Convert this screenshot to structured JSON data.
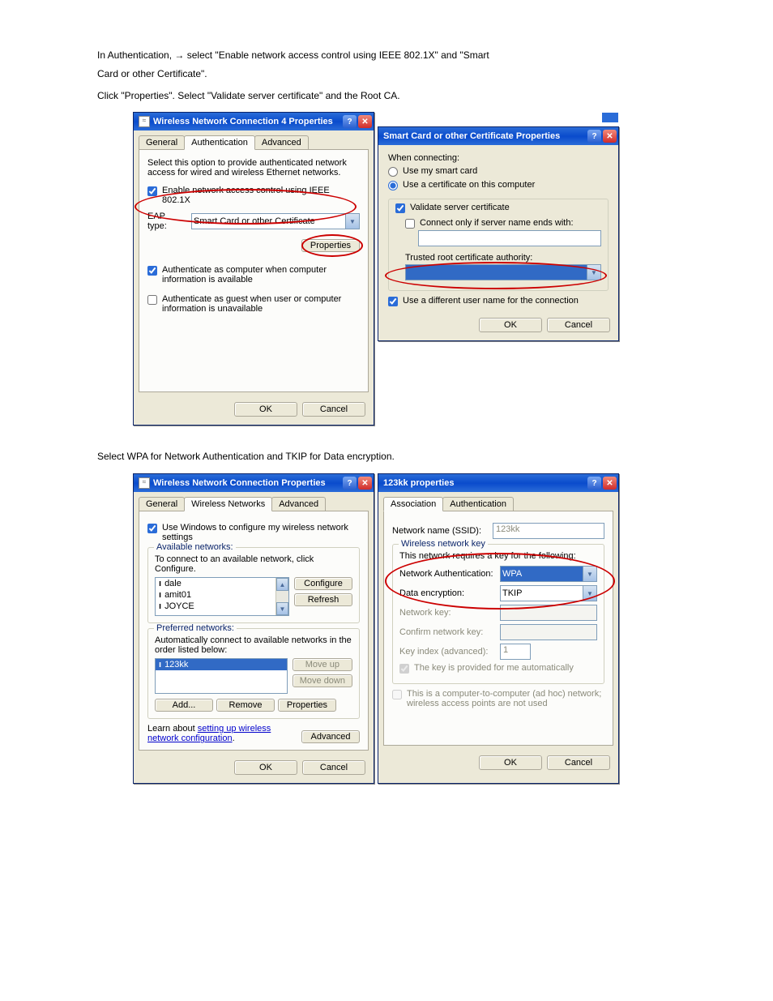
{
  "instructions": {
    "line1_part1": "In Authentication, ",
    "line1_part2": "select \"Enable network access control using IEEE 802.1X\" and \"Smart",
    "line2": "Card or other Certificate\".",
    "line3": "Click \"Properties\". Select \"Validate server certificate\" and the Root CA.",
    "arrow": "→",
    "lower_intro": "Select WPA for Network Authentication and TKIP for Data encryption."
  },
  "dlg1": {
    "title": "Wireless Network Connection 4 Properties",
    "tabs": {
      "general": "General",
      "auth": "Authentication",
      "adv": "Advanced"
    },
    "desc": "Select this option to provide authenticated network access for wired and wireless Ethernet networks.",
    "enable8021x": "Enable network access control using IEEE 802.1X",
    "eap_label": "EAP type:",
    "eap_value": "Smart Card or other Certificate",
    "properties": "Properties",
    "auth_computer": "Authenticate as computer when computer information is available",
    "auth_guest": "Authenticate as guest when user or computer information is unavailable",
    "ok": "OK",
    "cancel": "Cancel"
  },
  "dlg2": {
    "title": "Smart Card or other Certificate Properties",
    "when": "When connecting:",
    "use_smart": "Use my smart card",
    "use_cert": "Use a certificate on this computer",
    "validate": "Validate server certificate",
    "connect_only": "Connect only if server name ends with:",
    "trusted": "Trusted root certificate authority:",
    "diff_user": "Use a different user name for the connection",
    "ok": "OK",
    "cancel": "Cancel"
  },
  "dlg3": {
    "title": "Wireless Network Connection Properties",
    "tabs": {
      "general": "General",
      "wn": "Wireless Networks",
      "adv": "Advanced"
    },
    "use_windows": "Use Windows to configure my wireless network settings",
    "available": "Available networks:",
    "available_help": "To connect to an available network, click Configure.",
    "items": [
      "dale",
      "amit01",
      "JOYCE"
    ],
    "configure": "Configure",
    "refresh": "Refresh",
    "preferred": "Preferred networks:",
    "preferred_help": "Automatically connect to available networks in the order listed below:",
    "pref_items": [
      "123kk"
    ],
    "moveup": "Move up",
    "movedown": "Move down",
    "add": "Add...",
    "remove": "Remove",
    "properties": "Properties",
    "learn_pre": "Learn about ",
    "learn_link": "setting up wireless network configuration",
    "learn_post": ".",
    "advanced": "Advanced",
    "ok": "OK",
    "cancel": "Cancel"
  },
  "dlg4": {
    "title": "123kk properties",
    "tabs": {
      "assoc": "Association",
      "auth": "Authentication"
    },
    "ssid_label": "Network name (SSID):",
    "ssid_value": "123kk",
    "wkey_legend": "Wireless network key",
    "require": "This network requires a key for the following:",
    "netauth_label": "Network Authentication:",
    "netauth_value": "WPA",
    "dataenc_label": "Data encryption:",
    "dataenc_value": "TKIP",
    "netkey_label": "Network key:",
    "confirm_label": "Confirm network key:",
    "keyidx_label": "Key index (advanced):",
    "keyidx_value": "1",
    "provided": "The key is provided for me automatically",
    "adhoc": "This is a computer-to-computer (ad hoc) network; wireless access points are not used",
    "ok": "OK",
    "cancel": "Cancel"
  }
}
